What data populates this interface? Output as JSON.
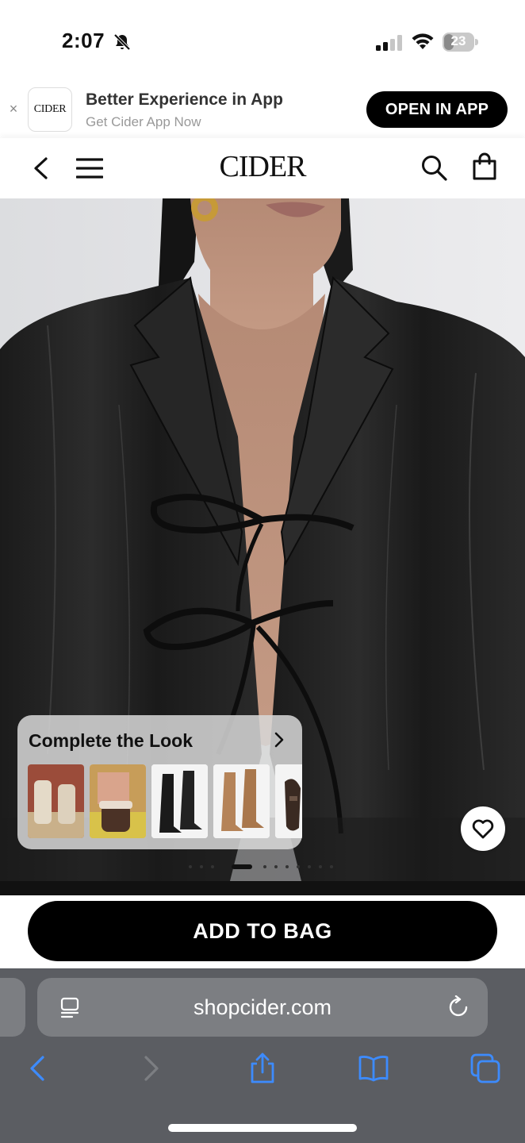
{
  "status_bar": {
    "time": "2:07",
    "battery": "23"
  },
  "app_banner": {
    "logo_text": "CIDER",
    "title": "Better Experience in App",
    "subtitle": "Get Cider App Now",
    "open_button": "OPEN IN APP"
  },
  "header": {
    "logo": "CIDER"
  },
  "complete_the_look": {
    "title": "Complete the Look",
    "items": [
      "beige-boots",
      "brown-fur-boots",
      "black-knee-boots",
      "tan-knee-boots",
      "black-loafer"
    ]
  },
  "add_to_bag": {
    "label": "ADD TO BAG"
  },
  "browser": {
    "url": "shopcider.com"
  },
  "colors": {
    "accent": "#000000",
    "safari_blue": "#3d8bfd",
    "browser_bg": "#5b5d62"
  }
}
